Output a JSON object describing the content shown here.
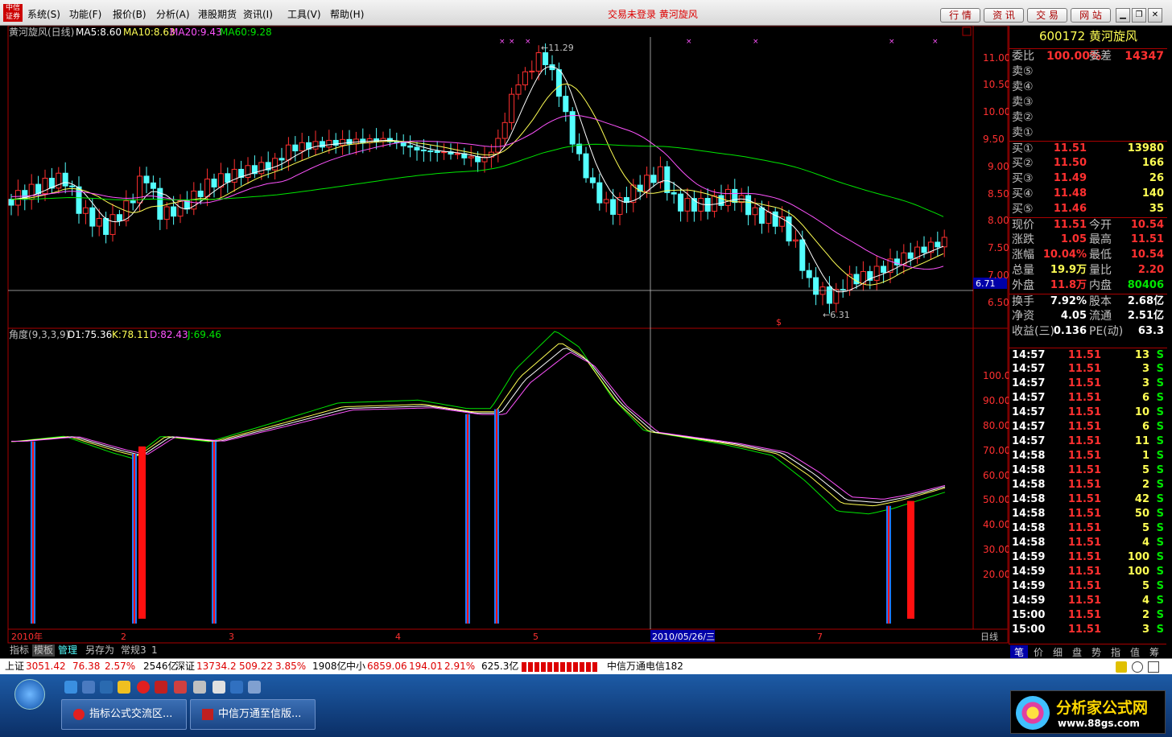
{
  "menubar": {
    "logo": "中信\n证券",
    "items": [
      "系统(S)",
      "功能(F)",
      "报价(B)",
      "分析(A)",
      "港股期货",
      "资讯(I)",
      "工具(V)",
      "帮助(H)"
    ],
    "status_title": "交易未登录  黄河旋风",
    "buttons": [
      "行 情",
      "资 讯",
      "交 易",
      "网 站"
    ]
  },
  "price_panel": {
    "title": "黄河旋风(日线)",
    "ma5": "MA5:8.60",
    "ma10": "MA10:8.63",
    "ma20": "MA20:9.43",
    "ma60": "MA60:9.28",
    "high_label": "11.29",
    "low_label": "6.31",
    "price_line": "6.71",
    "y_ticks": [
      "11.00",
      "10.50",
      "10.00",
      "9.50",
      "9.00",
      "8.50",
      "8.00",
      "7.50",
      "7.00",
      "6.50"
    ]
  },
  "indicator_panel": {
    "title": "角度(9,3,3,9)",
    "d1": "D1:75.36",
    "k": "K:78.11",
    "d": "D:82.43",
    "j": "J:69.46",
    "y_ticks": [
      "100.0",
      "90.00",
      "80.00",
      "70.00",
      "60.00",
      "50.00",
      "40.00",
      "30.00",
      "20.00"
    ]
  },
  "date_axis": {
    "labels": [
      "2010年",
      "2",
      "3",
      "4",
      "5",
      "7"
    ],
    "cursor_date": "2010/05/26/三",
    "period": "日线"
  },
  "colors": {
    "up": "#ff3030",
    "down": "#54ffff",
    "ma5": "#ffffff",
    "ma10": "#ffff54",
    "ma20": "#ff54ff",
    "ma60": "#00e600",
    "blue_bar": "#1e78ff",
    "red_bar": "#ff1010"
  },
  "quote": {
    "code": "600172",
    "name": "黄河旋风",
    "weibi_label": "委比",
    "weibi": "100.00%",
    "weicha_label": "委差",
    "weicha": "14347",
    "sells": [
      "卖⑤",
      "卖④",
      "卖③",
      "卖②",
      "卖①"
    ],
    "buys": [
      {
        "l": "买①",
        "p": "11.51",
        "v": "13980"
      },
      {
        "l": "买②",
        "p": "11.50",
        "v": "166"
      },
      {
        "l": "买③",
        "p": "11.49",
        "v": "26"
      },
      {
        "l": "买④",
        "p": "11.48",
        "v": "140"
      },
      {
        "l": "买⑤",
        "p": "11.46",
        "v": "35"
      }
    ],
    "stats": [
      {
        "a": "现价",
        "av": "11.51",
        "b": "今开",
        "bv": "10.54"
      },
      {
        "a": "涨跌",
        "av": "1.05",
        "b": "最高",
        "bv": "11.51"
      },
      {
        "a": "涨幅",
        "av": "10.04%",
        "b": "最低",
        "bv": "10.54"
      },
      {
        "a": "总量",
        "av": "19.9万",
        "b": "量比",
        "bv": "2.20"
      },
      {
        "a": "外盘",
        "av": "11.8万",
        "b": "内盘",
        "bv": "80406"
      },
      {
        "a": "换手",
        "av": "7.92%",
        "b": "股本",
        "bv": "2.68亿"
      },
      {
        "a": "净资",
        "av": "4.05",
        "b": "流通",
        "bv": "2.51亿"
      },
      {
        "a": "收益(三)",
        "av": "0.136",
        "b": "PE(动)",
        "bv": "63.3"
      }
    ]
  },
  "ticks": [
    {
      "t": "14:57",
      "p": "11.51",
      "v": "13",
      "s": "S"
    },
    {
      "t": "14:57",
      "p": "11.51",
      "v": "3",
      "s": "S"
    },
    {
      "t": "14:57",
      "p": "11.51",
      "v": "3",
      "s": "S"
    },
    {
      "t": "14:57",
      "p": "11.51",
      "v": "6",
      "s": "S"
    },
    {
      "t": "14:57",
      "p": "11.51",
      "v": "10",
      "s": "S"
    },
    {
      "t": "14:57",
      "p": "11.51",
      "v": "6",
      "s": "S"
    },
    {
      "t": "14:57",
      "p": "11.51",
      "v": "11",
      "s": "S"
    },
    {
      "t": "14:58",
      "p": "11.51",
      "v": "1",
      "s": "S"
    },
    {
      "t": "14:58",
      "p": "11.51",
      "v": "5",
      "s": "S"
    },
    {
      "t": "14:58",
      "p": "11.51",
      "v": "2",
      "s": "S"
    },
    {
      "t": "14:58",
      "p": "11.51",
      "v": "42",
      "s": "S"
    },
    {
      "t": "14:58",
      "p": "11.51",
      "v": "50",
      "s": "S"
    },
    {
      "t": "14:58",
      "p": "11.51",
      "v": "5",
      "s": "S"
    },
    {
      "t": "14:58",
      "p": "11.51",
      "v": "4",
      "s": "S"
    },
    {
      "t": "14:59",
      "p": "11.51",
      "v": "100",
      "s": "S"
    },
    {
      "t": "14:59",
      "p": "11.51",
      "v": "100",
      "s": "S"
    },
    {
      "t": "14:59",
      "p": "11.51",
      "v": "5",
      "s": "S"
    },
    {
      "t": "14:59",
      "p": "11.51",
      "v": "4",
      "s": "S"
    },
    {
      "t": "15:00",
      "p": "11.51",
      "v": "2",
      "s": "S"
    },
    {
      "t": "15:00",
      "p": "11.51",
      "v": "3",
      "s": "S"
    }
  ],
  "side_tabs": [
    "笔",
    "价",
    "细",
    "盘",
    "势",
    "指",
    "值",
    "筹"
  ],
  "bottom_tabs": [
    "指标",
    "模板",
    "管理",
    "另存为",
    "常规3",
    "1"
  ],
  "indexbar": {
    "sh_label": "上证",
    "sh": "3051.42",
    "sh_chg": "76.38",
    "sh_pct": "2.57%",
    "sh_amt": "2546亿",
    "sz_label": "深证",
    "sz": "13734.2",
    "sz_chg": "509.22",
    "sz_pct": "3.85%",
    "sz_amt": "1908亿",
    "zx_label": "中小",
    "zx": "6859.06",
    "zx_chg": "194.01",
    "zx_pct": "2.91%",
    "zx_amt": "625.3亿",
    "broker": "中信万通电信182"
  },
  "taskbar": {
    "windows": [
      "指标公式交流区...",
      "中信万通至信版..."
    ]
  },
  "brand": {
    "name": "分析家公式网",
    "url": "www.88gs.com"
  }
}
